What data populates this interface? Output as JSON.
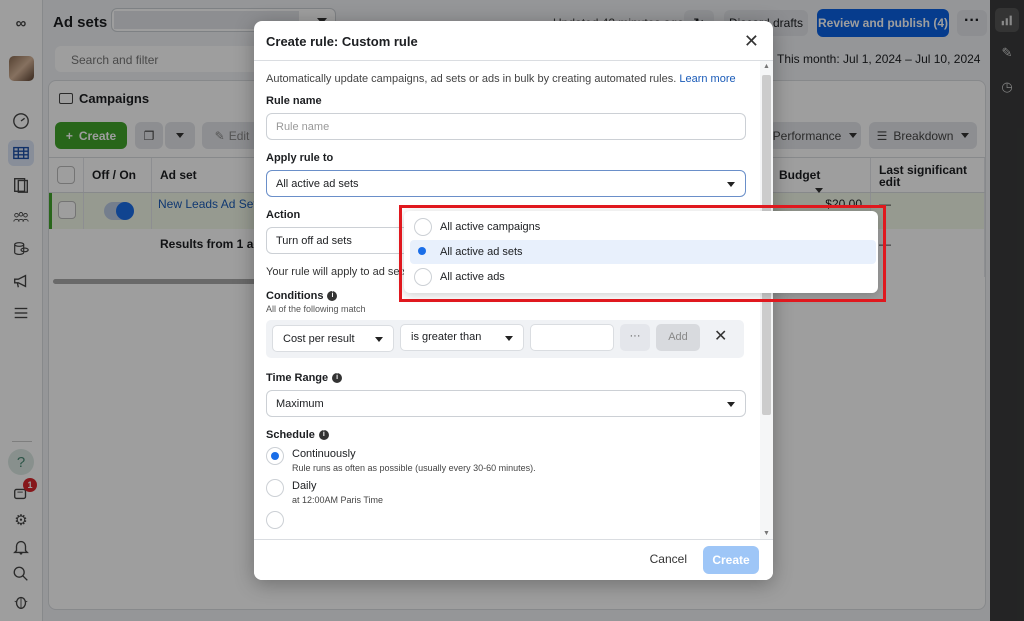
{
  "app": {
    "title": "Ad sets",
    "updated_text": "Updated 42 minutes ago",
    "discard_label": "Discard drafts",
    "publish_label": "Review and publish (4)",
    "more_label": "···",
    "search_placeholder": "Search and filter",
    "date_range": "This month: Jul 1, 2024 – Jul 10, 2024",
    "notification_count": "1",
    "accent_color": "#0a62e4"
  },
  "panel": {
    "title": "Campaigns",
    "toolbar": {
      "create_label": "Create",
      "edit_label": "Edit",
      "performance_label": "Performance",
      "breakdown_label": "Breakdown"
    },
    "columns": [
      "Off / On",
      "Ad set",
      "Budget",
      "Last significant edit"
    ],
    "rows": [
      {
        "name": "New Leads Ad Set",
        "budget": "$20.00",
        "last_edit": "—",
        "on": true
      }
    ],
    "summary_label": "Results from 1 ad set",
    "summary_last_edit": "—"
  },
  "modal": {
    "title": "Create rule: Custom rule",
    "description": "Automatically update campaigns, ad sets or ads in bulk by creating automated rules.",
    "learn_more": "Learn more",
    "rule_name_label": "Rule name",
    "rule_name_placeholder": "Rule name",
    "rule_name_value": "",
    "apply_label": "Apply rule to",
    "apply_value": "All active ad sets",
    "action_label": "Action",
    "action_value": "Turn off ad sets",
    "apply_note": "Your rule will apply to ad sets that are active at the time the rule runs.",
    "conditions_label": "Conditions",
    "conditions_sub": "All of the following match",
    "condition": {
      "metric": "Cost per result",
      "operator": "is greater than",
      "value": "",
      "more_label": "···",
      "add_label": "Add"
    },
    "time_range_label": "Time Range",
    "time_range_value": "Maximum",
    "schedule_label": "Schedule",
    "schedule_options": [
      {
        "title": "Continuously",
        "sub": "Rule runs as often as possible (usually every 30-60 minutes).",
        "selected": true
      },
      {
        "title": "Daily",
        "sub": "at 12:00AM Paris Time",
        "selected": false
      }
    ],
    "cancel_label": "Cancel",
    "create_label": "Create"
  },
  "dropdown": {
    "options": [
      {
        "label": "All active campaigns",
        "selected": false
      },
      {
        "label": "All active ad sets",
        "selected": true
      },
      {
        "label": "All active ads",
        "selected": false
      }
    ],
    "highlight_color": "#e0181e"
  }
}
